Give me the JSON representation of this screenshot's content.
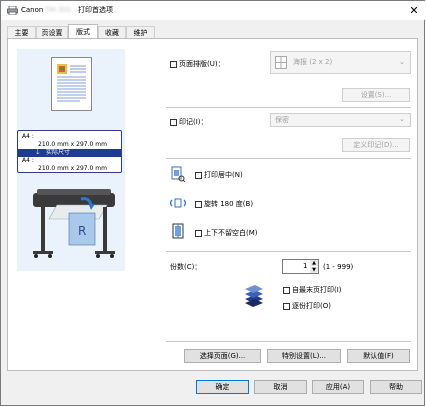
{
  "window": {
    "title_prefix": "Canon",
    "title_model": "TM-300",
    "title_suffix": "打印首选项",
    "close_glyph": "✕"
  },
  "tabs": [
    {
      "label": "主要",
      "active": false
    },
    {
      "label": "页设置",
      "active": false
    },
    {
      "label": "版式",
      "active": true
    },
    {
      "label": "收藏",
      "active": false
    },
    {
      "label": "维护",
      "active": false
    }
  ],
  "preview": {
    "size_box": {
      "line1_label": "A4 :",
      "line1_value": "210.0 mm x 297.0 mm",
      "actual_label": "实际尺寸",
      "line2_label": "A4 :",
      "line2_value": "210.0 mm x 297.0 mm"
    }
  },
  "layout": {
    "page_layout_label": "页面排版(U)：",
    "page_layout_checked": false,
    "page_layout_value": "海报 (2 x 2)",
    "settings_button": "设置(S)...",
    "stamp_label": "印记(I)：",
    "stamp_checked": false,
    "stamp_value": "保密",
    "define_stamp_button": "定义印记(D)...",
    "center_label": "打印居中(N)",
    "center_checked": false,
    "rotate_label": "旋转 180 度(B)",
    "rotate_checked": false,
    "nomargin_label": "上下不留空白(M)",
    "nomargin_checked": false,
    "copies_label": "份数(C)：",
    "copies_value": "1",
    "copies_range": "(1 - 999)",
    "last_page_first_label": "自最末页打印(I)",
    "last_page_first_checked": false,
    "collate_label": "逐份打印(O)",
    "collate_checked": false,
    "select_page_button": "选择页面(G)...",
    "special_settings_button": "特别设置(L)...",
    "defaults_button": "默认值(F)"
  },
  "footer": {
    "ok": "确定",
    "cancel": "取消",
    "apply": "应用(A)",
    "help": "帮助"
  },
  "colors": {
    "accent": "#0078d7",
    "highlight": "#1f3a93"
  }
}
